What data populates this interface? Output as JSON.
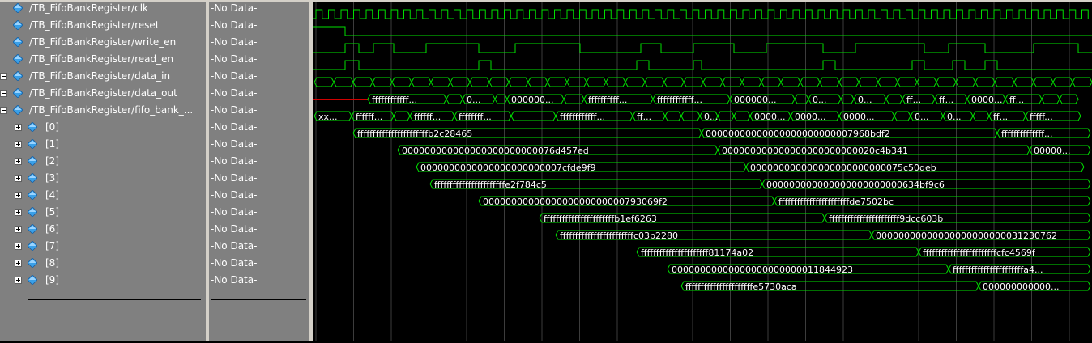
{
  "signals": [
    {
      "name": "/TB_FifoBankRegister/clk",
      "value": "-No Data-"
    },
    {
      "name": "/TB_FifoBankRegister/reset",
      "value": "-No Data-"
    },
    {
      "name": "/TB_FifoBankRegister/write_en",
      "value": "-No Data-"
    },
    {
      "name": "/TB_FifoBankRegister/read_en",
      "value": "-No Data-"
    },
    {
      "name": "/TB_FifoBankRegister/data_in",
      "value": "-No Data-"
    },
    {
      "name": "/TB_FifoBankRegister/data_out",
      "value": "-No Data-"
    },
    {
      "name": "/TB_FifoBankRegister/fifo_bank_...",
      "value": "-No Data-"
    },
    {
      "name": "[0]",
      "value": "-No Data-"
    },
    {
      "name": "[1]",
      "value": "-No Data-"
    },
    {
      "name": "[2]",
      "value": "-No Data-"
    },
    {
      "name": "[3]",
      "value": "-No Data-"
    },
    {
      "name": "[4]",
      "value": "-No Data-"
    },
    {
      "name": "[5]",
      "value": "-No Data-"
    },
    {
      "name": "[6]",
      "value": "-No Data-"
    },
    {
      "name": "[7]",
      "value": "-No Data-"
    },
    {
      "name": "[8]",
      "value": "-No Data-"
    },
    {
      "name": "[9]",
      "value": "-No Data-"
    }
  ],
  "wave_labels": {
    "data_out": [
      "ffffffffffff...",
      "0...",
      "000000...",
      "ffffffffff...",
      "ffffffffffff...",
      "000000...",
      "0...",
      "0...",
      "ff...",
      "ff...",
      "0000...",
      "ff..."
    ],
    "fifo_bank": [
      "xx...",
      "ffffff...",
      "ffffff...",
      "ffffffff...",
      "ffffffffffff...",
      "ff...",
      "0...",
      "0000...",
      "0000...",
      "0000...",
      "0...",
      "0...",
      "ff...",
      "fffff..."
    ],
    "elem0": [
      "fffffffffffffffffffffffb2c28465",
      "00000000000000000000000007968bdf2",
      "ffffffffffffff..."
    ],
    "elem1": [
      "000000000000000000000000076d457ed",
      "000000000000000000000000020c4b341",
      "00000..."
    ],
    "elem2": [
      "0000000000000000000000007cfde9f9",
      "000000000000000000000000075c50deb"
    ],
    "elem3": [
      "fffffffffffffffffffffffe2f784c5",
      "000000000000000000000000634bf9c6"
    ],
    "elem4": [
      "0000000000000000000000000793069f2",
      "fffffffffffffffffffffffde7502bc"
    ],
    "elem5": [
      "fffffffffffffffffffffffb1ef6263",
      "fffffffffffffffffffffff9dcc603b"
    ],
    "elem6": [
      "ffffffffffffffffffffffffc03b2280",
      "00000000000000000000000031230762"
    ],
    "elem7": [
      "ffffffffffffffffffffff81174a02",
      "ffffffffffffffffffffffffcfc4569f"
    ],
    "elem8": [
      "00000000000000000000000011844923",
      "fffffffffffffffffffffffa4..."
    ],
    "elem9": [
      "ffffffffffffffffffffffe5730aca",
      "000000000000..."
    ]
  }
}
